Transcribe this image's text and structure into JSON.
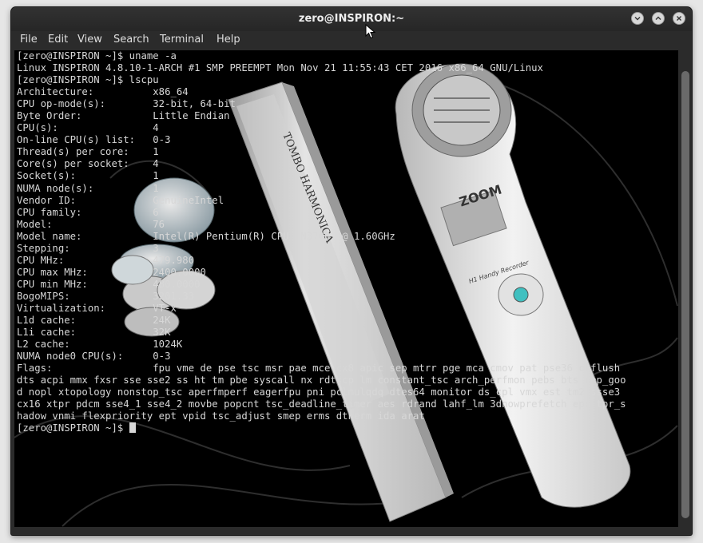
{
  "window": {
    "title": "zero@INSPIRON:~",
    "buttons": [
      "minimize-icon",
      "maximize-icon",
      "close-icon"
    ]
  },
  "menu": {
    "items": [
      "File",
      "Edit",
      "View",
      "Search",
      "Terminal",
      "Help"
    ]
  },
  "terminal": {
    "lines": [
      "[zero@INSPIRON ~]$ uname -a",
      "Linux INSPIRON 4.8.10-1-ARCH #1 SMP PREEMPT Mon Nov 21 11:55:43 CET 2016 x86_64 GNU/Linux",
      "[zero@INSPIRON ~]$ lscpu",
      "Architecture:          x86_64",
      "CPU op-mode(s):        32-bit, 64-bit",
      "Byte Order:            Little Endian",
      "CPU(s):                4",
      "On-line CPU(s) list:   0-3",
      "Thread(s) per core:    1",
      "Core(s) per socket:    4",
      "Socket(s):             1",
      "NUMA node(s):          1",
      "Vendor ID:             GenuineIntel",
      "CPU family:            6",
      "Model:                 76",
      "Model name:            Intel(R) Pentium(R) CPU  N3700  @ 1.60GHz",
      "Stepping:              3",
      "CPU MHz:               479.980",
      "CPU max MHz:           2400.0000",
      "CPU min MHz:           480.0000",
      "BogoMIPS:              3201.33",
      "Virtualization:        VT-x",
      "L1d cache:             24K",
      "L1i cache:             32K",
      "L2 cache:              1024K",
      "NUMA node0 CPU(s):     0-3",
      "Flags:                 fpu vme de pse tsc msr pae mce cx8 apic sep mtrr pge mca cmov pat pse36 clflush",
      "dts acpi mmx fxsr sse sse2 ss ht tm pbe syscall nx rdtscp lm constant_tsc arch_perfmon pebs bts rep_goo",
      "d nopl xtopology nonstop_tsc aperfmperf eagerfpu pni pclmulqdq dtes64 monitor ds_cpl vmx est tm2 ssse3",
      "cx16 xtpr pdcm sse4_1 sse4_2 movbe popcnt tsc_deadline_timer aes rdrand lahf_lm 3dnowprefetch epb tpr_s",
      "hadow vnmi flexpriority ept vpid tsc_adjust smep erms dtherm ida arat"
    ],
    "prompt": "[zero@INSPIRON ~]$ "
  },
  "background_image": {
    "label_brand": "TOMBO HARMONICA",
    "recorder_brand": "ZOOM",
    "recorder_model": "H1 Handy Recorder"
  },
  "colors": {
    "terminal_bg": "#000000",
    "terminal_fg": "#d7d7d7",
    "chrome": "#2b2b2b"
  }
}
